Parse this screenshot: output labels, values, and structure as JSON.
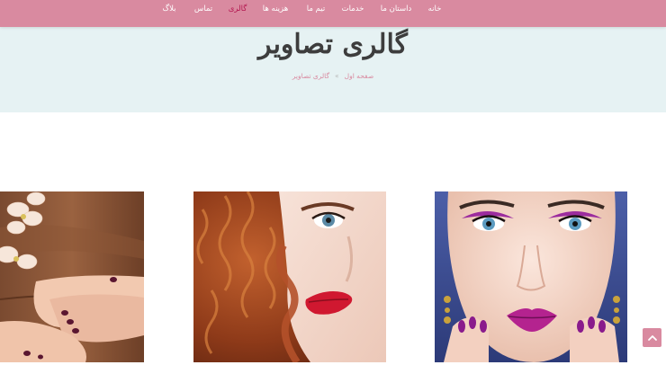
{
  "nav": {
    "items": [
      {
        "label": "خانه"
      },
      {
        "label": "داستان ما"
      },
      {
        "label": "خدمات"
      },
      {
        "label": "تیم ما"
      },
      {
        "label": "هزینه ها"
      },
      {
        "label": "گالری",
        "active": true
      },
      {
        "label": "تماس"
      },
      {
        "label": "بلاگ"
      }
    ]
  },
  "header": {
    "title": "گالری تصاویر",
    "breadcrumb": {
      "home": "صفحه اول",
      "separator": "»",
      "current": "گالری تصاویر"
    }
  },
  "gallery": {
    "images": [
      {
        "subject": "manicured hands and feet with orchids"
      },
      {
        "subject": "woman with curly red hair and red lips"
      },
      {
        "subject": "woman with purple makeup and purple nails"
      }
    ]
  },
  "scroll_top": {
    "icon": "chevron-up-icon"
  },
  "colors": {
    "brand": "#d98aa0",
    "active": "#b3164f",
    "header_bg": "#e6f2f3",
    "title": "#3d3d3d"
  }
}
